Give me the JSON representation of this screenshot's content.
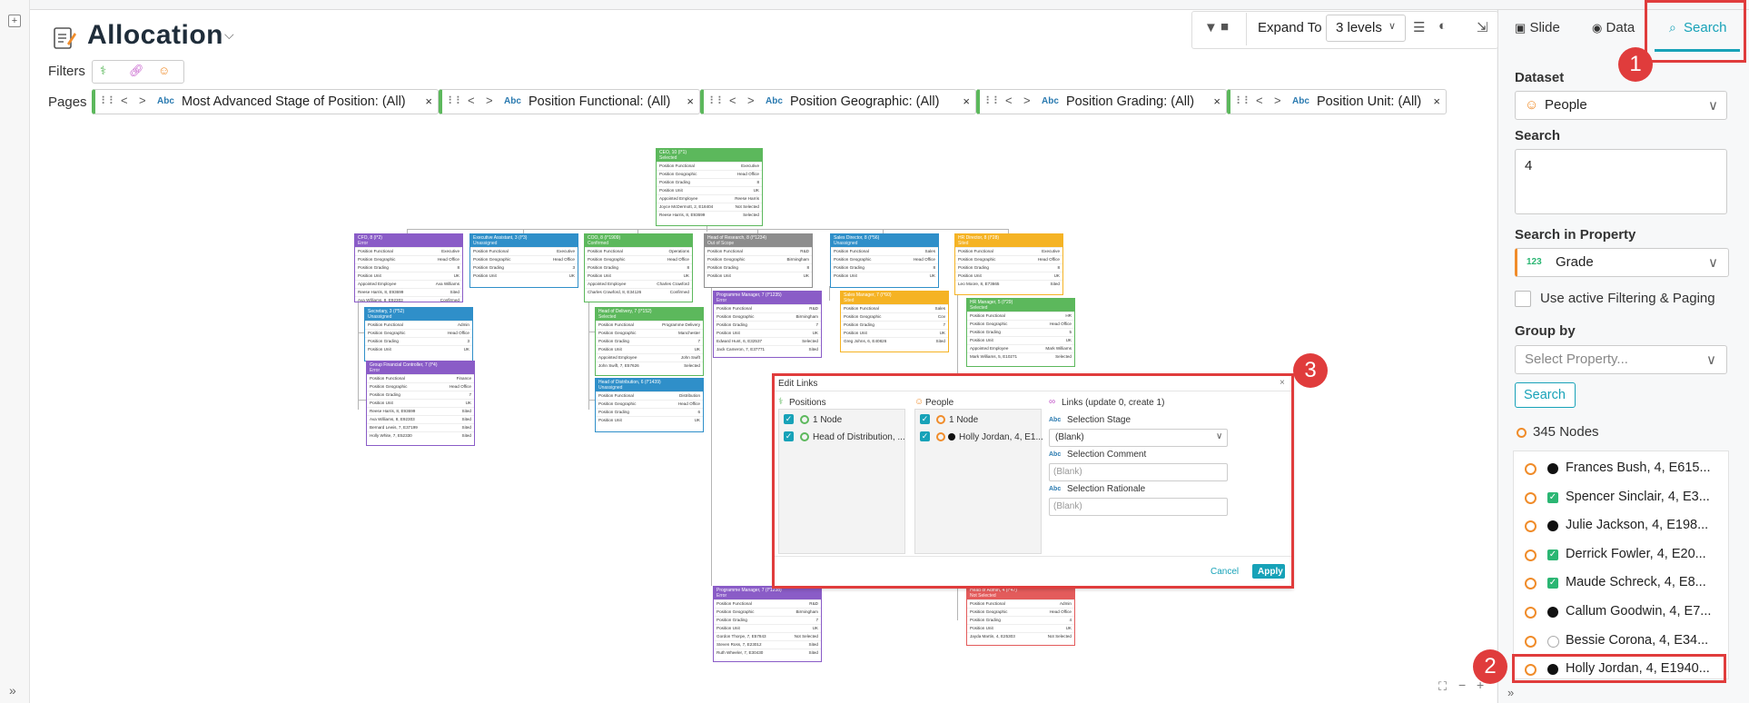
{
  "header": {
    "title": "Allocation",
    "filters_label": "Filters",
    "pages_label": "Pages"
  },
  "page_chips": [
    {
      "label": "Most Advanced Stage of Position: (All)"
    },
    {
      "label": "Position Functional: (All)"
    },
    {
      "label": "Position Geographic: (All)"
    },
    {
      "label": "Position Grading: (All)"
    },
    {
      "label": "Position Unit: (All)"
    }
  ],
  "chip_type_label": "Abc",
  "toolbar": {
    "expand_label": "Expand To",
    "levels_value": "3 levels"
  },
  "right_panel": {
    "tabs": {
      "slide": "Slide",
      "data": "Data",
      "search": "Search"
    },
    "dataset_label": "Dataset",
    "dataset_value": "People",
    "search_label": "Search",
    "search_value": "4",
    "property_label": "Search in Property",
    "property_type": "123",
    "property_value": "Grade",
    "active_filter_label": "Use active Filtering & Paging",
    "group_by_label": "Group by",
    "group_by_placeholder": "Select Property...",
    "search_button": "Search",
    "nodes_count": "345 Nodes",
    "results": [
      {
        "name": "Frances Bush, 4, E615...",
        "mark": "dot"
      },
      {
        "name": "Spencer Sinclair, 4, E3...",
        "mark": "check"
      },
      {
        "name": "Julie Jackson, 4, E198...",
        "mark": "dot"
      },
      {
        "name": "Derrick Fowler, 4, E20...",
        "mark": "check"
      },
      {
        "name": "Maude Schreck, 4, E8...",
        "mark": "check"
      },
      {
        "name": "Callum Goodwin, 4, E7...",
        "mark": "dot"
      },
      {
        "name": "Bessie Corona, 4, E34...",
        "mark": "empty"
      },
      {
        "name": "Holly Jordan, 4, E1940...",
        "mark": "dot"
      }
    ]
  },
  "dialog": {
    "title": "Edit Links",
    "positions_label": "Positions",
    "positions_count": "1 Node",
    "positions_item": "Head of Distribution, ...",
    "people_label": "People",
    "people_count": "1 Node",
    "people_item": "Holly Jordan, 4, E1...",
    "links_label": "Links (update 0, create 1)",
    "field_type": "Abc",
    "stage_label": "Selection Stage",
    "stage_value": "(Blank)",
    "comment_label": "Selection Comment",
    "comment_placeholder": "(Blank)",
    "rationale_label": "Selection Rationale",
    "rationale_placeholder": "(Blank)",
    "cancel": "Cancel",
    "apply": "Apply"
  },
  "annotations": {
    "one": "1",
    "two": "2",
    "three": "3"
  },
  "colors": {
    "accent": "#17a2b8",
    "annotation_red": "#e03c3c",
    "green": "#5cb85c",
    "orange": "#f08c2a",
    "purple": "#8a5cc7",
    "blue": "#2f8fc9",
    "gray": "#8d8d8d",
    "amber": "#f5b324",
    "red": "#e35b5b"
  },
  "org_cards": [
    {
      "title": "CEO, 10 (I*1)",
      "sub": "Selected",
      "color": "green",
      "rows": [
        [
          "Position Functional",
          "Executive"
        ],
        [
          "Position Geographic",
          "Head Office"
        ],
        [
          "Position Grading",
          "8"
        ],
        [
          "Position Unit",
          "UK"
        ],
        [
          "Appointed Employee",
          "Reese Harris"
        ],
        [
          "Joyce McDermott, 2, E18404",
          "Not Selected"
        ],
        [
          "Reese Harris, 8, E93699",
          "Selected"
        ]
      ]
    },
    {
      "title": "CFO, 8 (I*2)",
      "sub": "Error",
      "color": "purple",
      "rows": [
        [
          "Position Functional",
          "Executive"
        ],
        [
          "Position Geographic",
          "Head Office"
        ],
        [
          "Position Grading",
          "8"
        ],
        [
          "Position Unit",
          "UK"
        ],
        [
          "Appointed Employee",
          "Ava Williams"
        ],
        [
          "Reese Harris, 8, E93699",
          "Sited"
        ],
        [
          "Ava Williams, 8, E92303",
          "Confirmed"
        ]
      ]
    },
    {
      "title": "Executive Assistant, 3 (I*3)",
      "sub": "Unassigned",
      "color": "blue",
      "rows": [
        [
          "Position Functional",
          "Executive"
        ],
        [
          "Position Geographic",
          "Head Office"
        ],
        [
          "Position Grading",
          "3"
        ],
        [
          "Position Unit",
          "UK"
        ]
      ]
    },
    {
      "title": "COO, 8 (I*1909)",
      "sub": "Confirmed",
      "color": "green",
      "rows": [
        [
          "Position Functional",
          "Operations"
        ],
        [
          "Position Geographic",
          "Head Office"
        ],
        [
          "Position Grading",
          "8"
        ],
        [
          "Position Unit",
          "UK"
        ],
        [
          "Appointed Employee",
          "Charles Crawford"
        ],
        [
          "Charles Crawford, 8, E34126",
          "Confirmed"
        ]
      ]
    },
    {
      "title": "Head of Research, 8 (I*1234)",
      "sub": "Out of Scope",
      "color": "gray",
      "rows": [
        [
          "Position Functional",
          "R&D"
        ],
        [
          "Position Geographic",
          "Birmingham"
        ],
        [
          "Position Grading",
          "8"
        ],
        [
          "Position Unit",
          "UK"
        ]
      ]
    },
    {
      "title": "Sales Director, 8 (I*56)",
      "sub": "Unassigned",
      "color": "blue",
      "rows": [
        [
          "Position Functional",
          "Sales"
        ],
        [
          "Position Geographic",
          "Head Office"
        ],
        [
          "Position Grading",
          "8"
        ],
        [
          "Position Unit",
          "UK"
        ]
      ]
    },
    {
      "title": "HR Director, 8 (I*28)",
      "sub": "Sited",
      "color": "amber",
      "rows": [
        [
          "Position Functional",
          "Executive"
        ],
        [
          "Position Geographic",
          "Head Office"
        ],
        [
          "Position Grading",
          "8"
        ],
        [
          "Position Unit",
          "UK"
        ],
        [
          "Leo Moore, 8, E73665",
          "Sited"
        ]
      ]
    },
    {
      "title": "Secretary, 3 (I*52)",
      "sub": "Unassigned",
      "color": "blue",
      "rows": [
        [
          "Position Functional",
          "Admin"
        ],
        [
          "Position Geographic",
          "Head Office"
        ],
        [
          "Position Grading",
          "3"
        ],
        [
          "Position Unit",
          "UK"
        ]
      ]
    },
    {
      "title": "Group Financial Controller, 7 (I*4)",
      "sub": "Error",
      "color": "purple",
      "rows": [
        [
          "Position Functional",
          "Finance"
        ],
        [
          "Position Geographic",
          "Head Office"
        ],
        [
          "Position Grading",
          "7"
        ],
        [
          "Position Unit",
          "UK"
        ],
        [
          "Reese Harris, 8, E93699",
          "Sited"
        ],
        [
          "Ava Williams, 8, E92303",
          "Sited"
        ],
        [
          "Bernard Lewis, 7, E37199",
          "Sited"
        ],
        [
          "Holly White, 7, E52330",
          "Sited"
        ]
      ]
    },
    {
      "title": "Head of Delivery, 7 (I*152)",
      "sub": "Selected",
      "color": "green",
      "rows": [
        [
          "Position Functional",
          "Programme Delivery"
        ],
        [
          "Position Geographic",
          "Manchester"
        ],
        [
          "Position Grading",
          "7"
        ],
        [
          "Position Unit",
          "UK"
        ],
        [
          "Appointed Employee",
          "John Swift"
        ],
        [
          "John Swift, 7, E57626",
          "Selected"
        ]
      ]
    },
    {
      "title": "Head of Distribution, 6 (I*1439)",
      "sub": "Unassigned",
      "color": "blue",
      "rows": [
        [
          "Position Functional",
          "Distribution"
        ],
        [
          "Position Geographic",
          "Head Office"
        ],
        [
          "Position Grading",
          "6"
        ],
        [
          "Position Unit",
          "UK"
        ]
      ]
    },
    {
      "title": "Programme Manager, 7 (I*1235)",
      "sub": "Error",
      "color": "purple",
      "rows": [
        [
          "Position Functional",
          "R&D"
        ],
        [
          "Position Geographic",
          "Birmingham"
        ],
        [
          "Position Grading",
          "7"
        ],
        [
          "Position Unit",
          "UK"
        ],
        [
          "Edward Hunt, 6, E32537",
          "Selected"
        ],
        [
          "Jack Cameron, 7, E37771",
          "Sited"
        ]
      ]
    },
    {
      "title": "Sales Manager, 7 (I*60)",
      "sub": "Sited",
      "color": "amber",
      "rows": [
        [
          "Position Functional",
          "Sales"
        ],
        [
          "Position Geographic",
          "Cov"
        ],
        [
          "Position Grading",
          "7"
        ],
        [
          "Position Unit",
          "UK"
        ],
        [
          "Greg Johns, 6, E40826",
          "Sited"
        ]
      ]
    },
    {
      "title": "HR Manager, 5 (I*29)",
      "sub": "Selected",
      "color": "green",
      "rows": [
        [
          "Position Functional",
          "HR"
        ],
        [
          "Position Geographic",
          "Head Office"
        ],
        [
          "Position Grading",
          "5"
        ],
        [
          "Position Unit",
          "UK"
        ],
        [
          "Appointed Employee",
          "Mark Williams"
        ],
        [
          "Mark Williams, 5, E10271",
          "Selected"
        ]
      ]
    },
    {
      "title": "Programme Manager, 7 (I*1238)",
      "sub": "Error",
      "color": "purple",
      "rows": [
        [
          "Position Functional",
          "R&D"
        ],
        [
          "Position Geographic",
          "Birmingham"
        ],
        [
          "Position Grading",
          "7"
        ],
        [
          "Position Unit",
          "UK"
        ],
        [
          "Gordon Thorpe, 7, E57843",
          "Not Selected"
        ],
        [
          "Steven Ross, 7, E23012",
          "Sited"
        ],
        [
          "Ruth Wheeler, 7, E30430",
          "Sited"
        ]
      ]
    },
    {
      "title": "Head of Admin, 4 (I*47)",
      "sub": "Not Selected",
      "color": "red",
      "rows": [
        [
          "Position Functional",
          "Admin"
        ],
        [
          "Position Geographic",
          "Head Office"
        ],
        [
          "Position Grading",
          "4"
        ],
        [
          "Position Unit",
          "UK"
        ],
        [
          "Jayda Martin, 4, E25303",
          "Not Selected"
        ]
      ]
    }
  ]
}
